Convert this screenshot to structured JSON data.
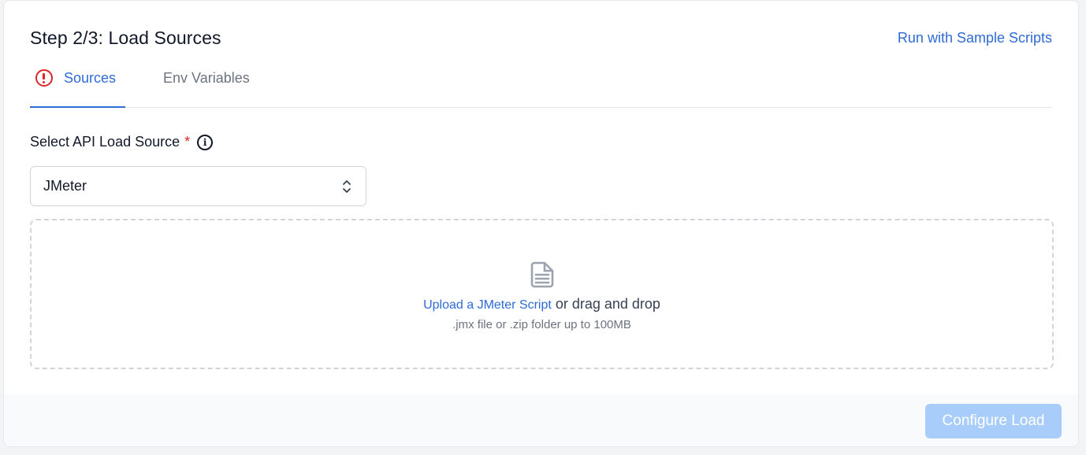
{
  "header": {
    "title": "Step 2/3: Load Sources",
    "sample_link": "Run with Sample Scripts"
  },
  "tabs": [
    {
      "label": "Sources",
      "icon": "alert-circle-icon",
      "active": true
    },
    {
      "label": "Env Variables",
      "active": false
    }
  ],
  "form": {
    "label": "Select API Load Source",
    "required_mark": "*",
    "selected_value": "JMeter"
  },
  "dropzone": {
    "upload_link": "Upload a JMeter Script",
    "upload_text": " or drag and drop",
    "hint": ".jmx file or .zip folder up to 100MB"
  },
  "footer": {
    "configure_label": "Configure Load"
  },
  "colors": {
    "accent": "#2f6bd6",
    "error": "#dc2626",
    "disabled_button": "#a9cdfb"
  }
}
